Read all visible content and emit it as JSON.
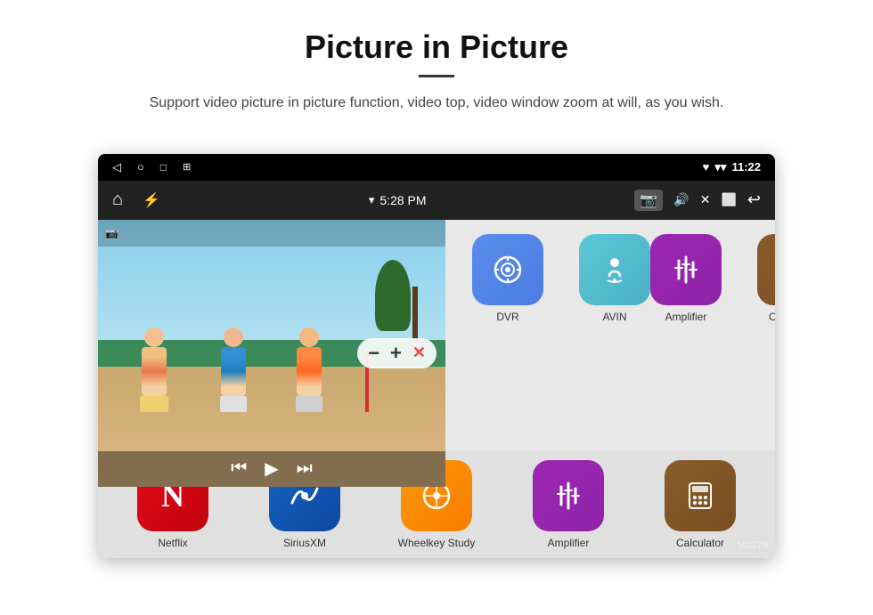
{
  "header": {
    "title": "Picture in Picture",
    "divider": true,
    "subtitle": "Support video picture in picture function, video top, video window zoom at will, as you wish."
  },
  "device": {
    "statusBar": {
      "left": [
        "◁",
        "○",
        "□",
        "⊞"
      ],
      "time": "11:22",
      "rightIcons": [
        "♥",
        "▼"
      ]
    },
    "appBar": {
      "homeIcon": "⌂",
      "usbIcon": "⚡",
      "wifiIcon": "▼",
      "time": "5:28 PM",
      "cameraIcon": "📷",
      "soundIcon": "🔊",
      "closeIcon": "✕",
      "windowIcon": "⬜",
      "backIcon": "↩"
    },
    "apps": {
      "topRow": [
        {
          "name": "DVR",
          "color": "#5b8dee",
          "icon": "🎯"
        },
        {
          "name": "AVIN",
          "color": "#5bc8d8",
          "icon": "🖱"
        }
      ],
      "bottomRow": [
        {
          "name": "Netflix",
          "color": "#e50914",
          "icon": "N"
        },
        {
          "name": "SiriusXM",
          "color": "#2196f3",
          "icon": "S"
        },
        {
          "name": "Wheelkey Study",
          "color": "#ff9800",
          "icon": "W"
        },
        {
          "name": "Amplifier",
          "color": "#9c27b0",
          "icon": "≡"
        },
        {
          "name": "Calculator",
          "color": "#795548",
          "icon": "#"
        }
      ]
    },
    "pip": {
      "zoomMinus": "−",
      "zoomPlus": "+",
      "close": "✕",
      "prevIcon": "⏮",
      "playIcon": "⏵",
      "nextIcon": "⏭"
    }
  },
  "watermark": "VC279"
}
